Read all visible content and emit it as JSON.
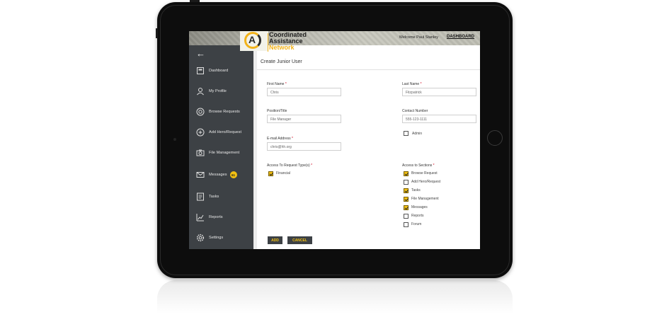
{
  "header": {
    "brand_line1": "Coordinated",
    "brand_line2": "Assistance",
    "brand_line3": "Network",
    "welcome": "Welcome Paul Stanley",
    "dashboard_link": "DASHBOARD"
  },
  "sidebar": {
    "back_icon": "back-arrow-icon",
    "items": [
      {
        "label": "Dashboard",
        "icon": "dashboard-icon"
      },
      {
        "label": "My Profile",
        "icon": "profile-icon"
      },
      {
        "label": "Browse Requests",
        "icon": "lifebuoy-icon"
      },
      {
        "label": "Add Hero/Request",
        "icon": "add-circle-icon"
      },
      {
        "label": "File Management",
        "icon": "camera-icon"
      },
      {
        "label": "Messages",
        "icon": "envelope-icon",
        "badge": "61"
      },
      {
        "label": "Tasks",
        "icon": "tasks-icon"
      },
      {
        "label": "Reports",
        "icon": "reports-icon"
      },
      {
        "label": "Settings",
        "icon": "gear-icon"
      }
    ]
  },
  "form": {
    "title": "Create Junior User",
    "first_name": {
      "label": "First Name",
      "value": "Chris"
    },
    "last_name": {
      "label": "Last Name",
      "value": "Fitzpatrick"
    },
    "position": {
      "label": "Position/Title",
      "value": "File Manager"
    },
    "contact": {
      "label": "Contact Number",
      "value": "555-123-1111"
    },
    "admin": {
      "label": "Admin",
      "checked": false
    },
    "email": {
      "label": "E-mail Address",
      "value": "chris@hh.org"
    },
    "request_types": {
      "label": "Access To Request Type(s)",
      "options": [
        {
          "label": "Financial",
          "checked": true
        }
      ]
    },
    "sections": {
      "label": "Access to Sections",
      "options": [
        {
          "label": "Browse Request",
          "checked": true
        },
        {
          "label": "Add Hero/Request",
          "checked": false
        },
        {
          "label": "Tasks",
          "checked": true
        },
        {
          "label": "File Management",
          "checked": true
        },
        {
          "label": "Messages",
          "checked": true
        },
        {
          "label": "Reports",
          "checked": false
        },
        {
          "label": "Forum",
          "checked": false
        }
      ]
    },
    "required_mark": "*",
    "add_button": "ADD",
    "cancel_button": "CANCEL"
  },
  "colors": {
    "accent": "#f2c012",
    "sidebar_bg": "#3d4145",
    "required": "#d0021b"
  }
}
